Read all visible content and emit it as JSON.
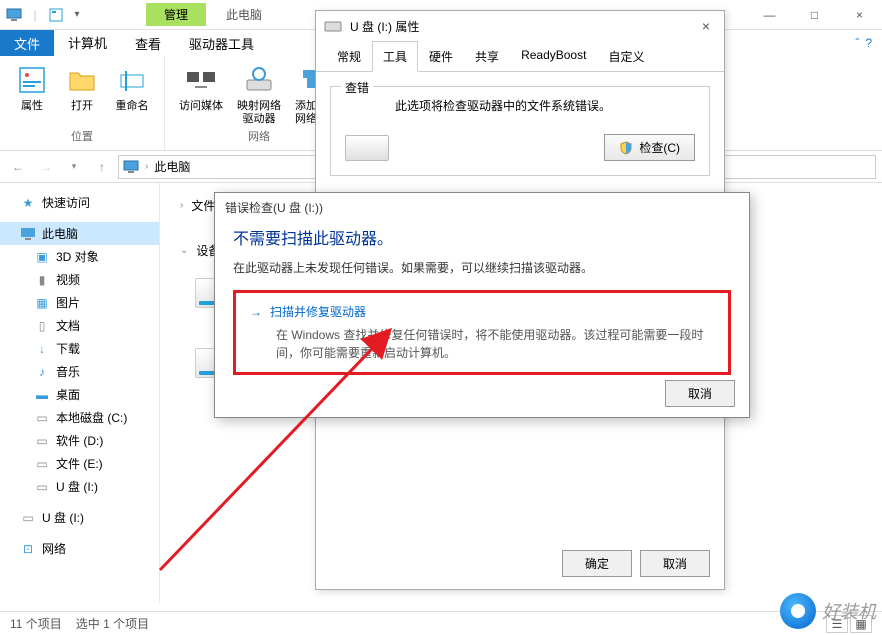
{
  "titlebar": {
    "mgmt": "管理",
    "title": "此电脑"
  },
  "wincontrols": {
    "min": "—",
    "max": "□",
    "close": "×"
  },
  "menu": {
    "file": "文件",
    "computer": "计算机",
    "view": "查看",
    "tools": "驱动器工具"
  },
  "ribbon": {
    "loc": {
      "props": "属性",
      "open": "打开",
      "rename": "重命名",
      "group": "位置"
    },
    "net": {
      "media": "访问媒体",
      "map": "映射网络\n驱动器",
      "add": "添加一个\n网络位置",
      "group": "网络"
    }
  },
  "addr": {
    "label": "此电脑"
  },
  "sidebar": {
    "quick": "快速访问",
    "thispc": "此电脑",
    "obj3d": "3D 对象",
    "videos": "视频",
    "pictures": "图片",
    "docs": "文档",
    "downloads": "下载",
    "music": "音乐",
    "desktop": "桌面",
    "cdrive": "本地磁盘 (C:)",
    "ddrive": "软件 (D:)",
    "edrive": "文件 (E:)",
    "udrive": "U 盘 (I:)",
    "udrive2": "U 盘 (I:)",
    "network": "网络"
  },
  "content": {
    "folders": "文件夹",
    "devices": "设备和"
  },
  "status": {
    "count": "11 个项目",
    "sel": "选中 1 个项目"
  },
  "prop": {
    "title": "U 盘 (I:) 属性",
    "tabs": {
      "general": "常规",
      "tools": "工具",
      "hardware": "硬件",
      "sharing": "共享",
      "readyboost": "ReadyBoost",
      "custom": "自定义"
    },
    "errcheck": {
      "legend": "查错",
      "desc": "此选项将检查驱动器中的文件系统错误。",
      "btn": "检查(C)"
    },
    "ok": "确定",
    "cancel": "取消"
  },
  "err": {
    "title": "错误检查(U 盘 (I:))",
    "heading": "不需要扫描此驱动器。",
    "msg": "在此驱动器上未发现任何错误。如果需要，可以继续扫描该驱动器。",
    "action_h": "扫描并修复驱动器",
    "action_p": "在 Windows 查找并修复任何错误时，将不能使用驱动器。该过程可能需要一段时间，你可能需要重新启动计算机。",
    "cancel": "取消"
  },
  "watermark": "好装机"
}
